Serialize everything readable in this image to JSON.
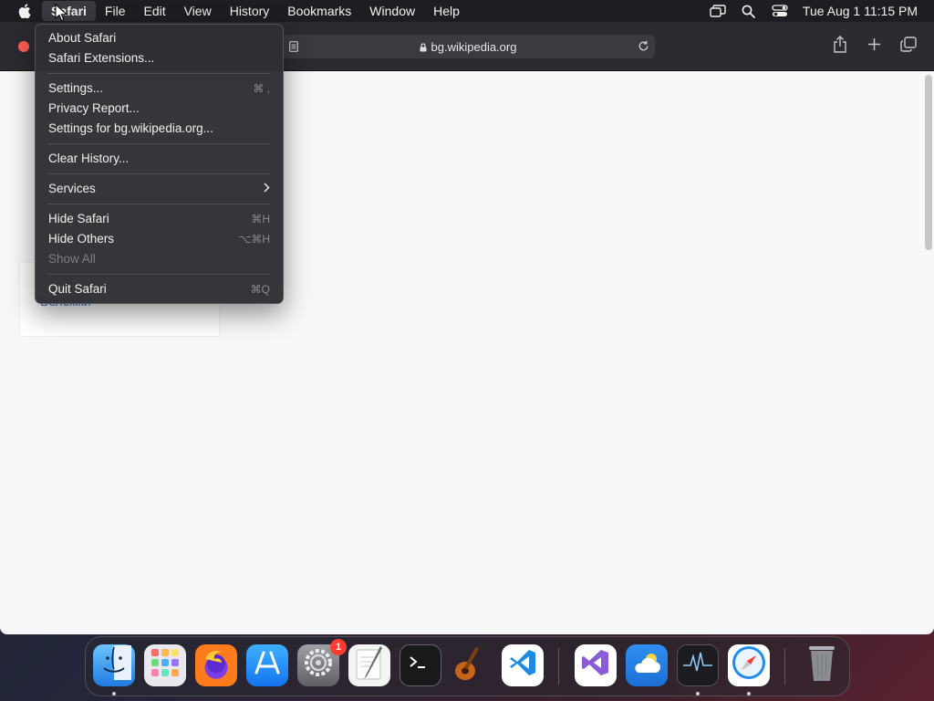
{
  "menubar": {
    "app_name": "Safari",
    "items": [
      "File",
      "Edit",
      "View",
      "History",
      "Bookmarks",
      "Window",
      "Help"
    ],
    "clock": "Tue Aug 1  11:15 PM"
  },
  "toolbar": {
    "url": "bg.wikipedia.org"
  },
  "page": {
    "link_text": "Бележки"
  },
  "safari_menu": {
    "about": "About Safari",
    "extensions": "Safari Extensions...",
    "settings": "Settings...",
    "settings_sc": "⌘ ,",
    "privacy": "Privacy Report...",
    "site_settings": "Settings for bg.wikipedia.org...",
    "clear_history": "Clear History...",
    "services": "Services",
    "hide": "Hide Safari",
    "hide_sc": "⌘H",
    "hide_others": "Hide Others",
    "hide_others_sc": "⌥⌘H",
    "show_all": "Show All",
    "quit": "Quit Safari",
    "quit_sc": "⌘Q"
  },
  "dock": {
    "settings_badge": "1"
  },
  "colors": {
    "menubar_bg": "#1e1e22",
    "menu_bg": "#303034",
    "close_button": "#ff5f57",
    "badge": "#ff3b30",
    "link": "#3366cc"
  }
}
